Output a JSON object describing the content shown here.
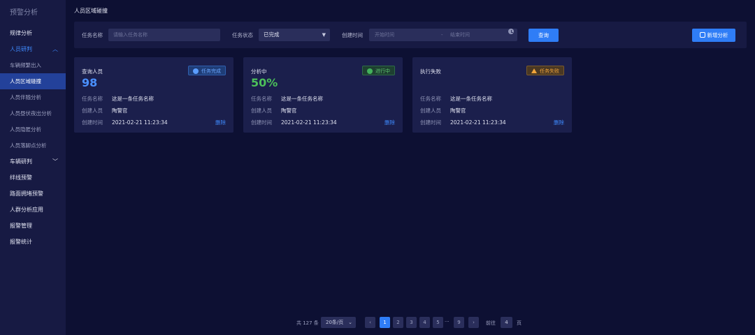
{
  "sidebar": {
    "title": "预警分析",
    "items": [
      {
        "label": "规律分析"
      },
      {
        "label": "人员研判",
        "expanded": true,
        "children": [
          "车辆频繁出入",
          "人员区域碰撞",
          "人员伴随分析",
          "人员昼伏夜出分析",
          "人员隐匿分析",
          "人员落脚点分析"
        ],
        "active_child": "人员区域碰撞"
      },
      {
        "label": "车辆研判",
        "expanded": false
      },
      {
        "label": "绊线预警"
      },
      {
        "label": "路面拥堵预警"
      },
      {
        "label": "人群分析应用"
      },
      {
        "label": "报警管理"
      },
      {
        "label": "报警统计"
      }
    ]
  },
  "page": {
    "title": "人员区域碰撞"
  },
  "filters": {
    "task_name_label": "任务名称",
    "task_name_placeholder": "请输入任务名称",
    "task_status_label": "任务状态",
    "task_status_value": "已完成",
    "create_time_label": "创建时间",
    "start_placeholder": "开始时间",
    "range_separator": "-",
    "end_placeholder": "结束时间",
    "query_button": "查询",
    "add_button": "新增分析"
  },
  "cards": [
    {
      "title": "查询人员",
      "value": "98",
      "value_color": "#4a90ff",
      "badge": "任务完成",
      "badge_type": "done",
      "fields": [
        {
          "k": "任务名称",
          "v": "这是一条任务名称"
        },
        {
          "k": "创建人员",
          "v": "陶警官"
        },
        {
          "k": "创建时间",
          "v": "2021-02-21 11:23:34"
        }
      ],
      "delete_label": "删除"
    },
    {
      "title": "分析中",
      "value": "50%",
      "value_color": "#4cc05a",
      "badge": "进行中",
      "badge_type": "run",
      "fields": [
        {
          "k": "任务名称",
          "v": "这是一条任务名称"
        },
        {
          "k": "创建人员",
          "v": "陶警官"
        },
        {
          "k": "创建时间",
          "v": "2021-02-21 11:23:34"
        }
      ],
      "delete_label": "删除"
    },
    {
      "title": "执行失败",
      "value": "",
      "badge": "任务失败",
      "badge_type": "fail",
      "fields": [
        {
          "k": "任务名称",
          "v": "这是一条任务名称"
        },
        {
          "k": "创建人员",
          "v": "陶警官"
        },
        {
          "k": "创建时间",
          "v": "2021-02-21 11:23:34"
        }
      ],
      "delete_label": "删除"
    }
  ],
  "pagination": {
    "total_text": "共 127 条",
    "page_size": "20条/页",
    "pages": [
      "1",
      "2",
      "3",
      "4",
      "5"
    ],
    "ellipsis": "···",
    "last_page": "9",
    "current": "1",
    "goto_label": "前往",
    "goto_value": "4",
    "page_suffix": "页"
  },
  "colors": {
    "accent": "#2f7df6",
    "background": "#0d1033",
    "sidebar": "#171a43"
  }
}
